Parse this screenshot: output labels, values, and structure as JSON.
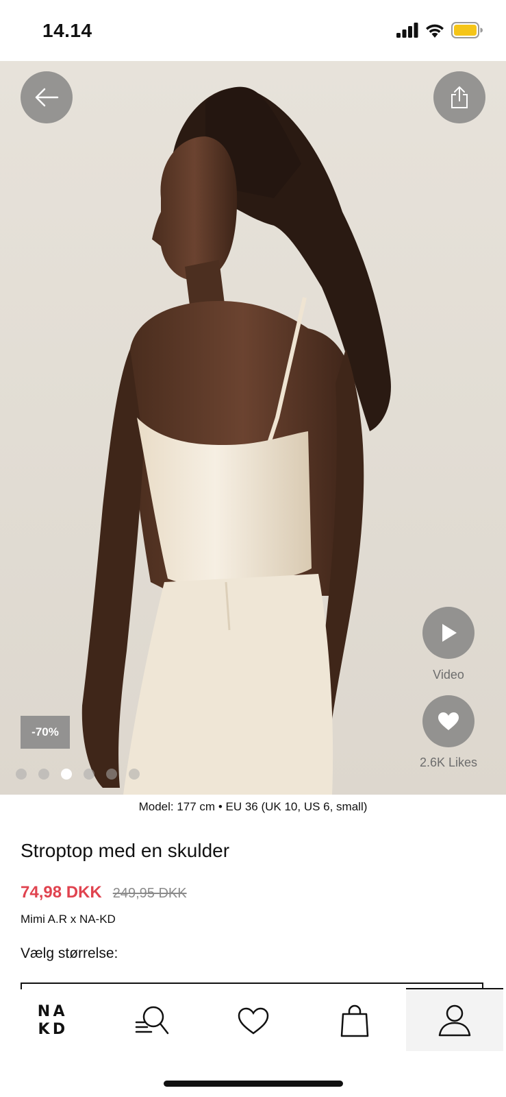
{
  "status_bar": {
    "time": "14.14",
    "battery_color": "#f5c518"
  },
  "hero": {
    "discount_badge": "-70%",
    "video_label": "Video",
    "likes_label": "2.6K Likes",
    "image_count": 6,
    "active_image_index": 2
  },
  "product": {
    "model_info": "Model: 177 cm • EU 36 (UK 10, US 6, small)",
    "title": "Stroptop med en skulder",
    "price_sale": "74,98 DKK",
    "price_original": "249,95 DKK",
    "brand": "Mimi A.R x NA-KD",
    "size_label": "Vælg størrelse:"
  },
  "nav": {
    "logo_letters": [
      "N",
      "A",
      "K",
      "D"
    ],
    "items": [
      "home",
      "search",
      "wishlist",
      "bag",
      "account"
    ],
    "active": "account"
  },
  "colors": {
    "sale": "#e0434f",
    "accent": "#111111"
  }
}
